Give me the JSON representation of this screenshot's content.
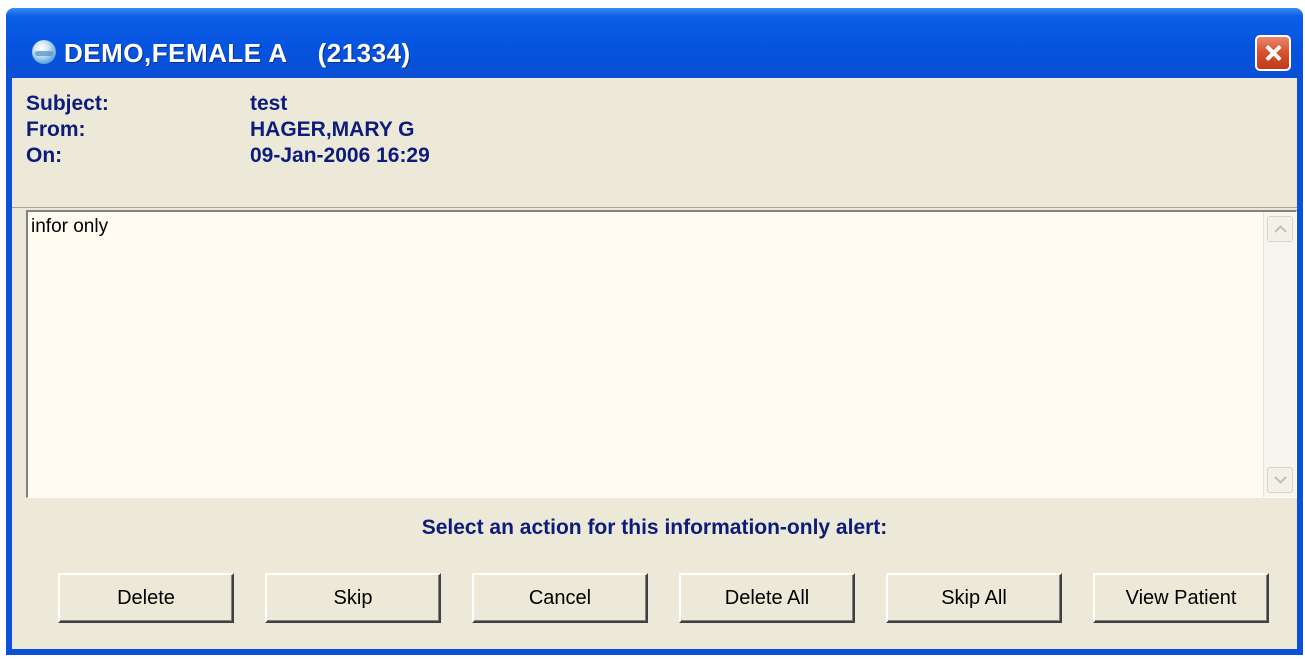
{
  "window": {
    "title": "DEMO,FEMALE A    (21334)",
    "close_icon": "close-icon"
  },
  "header": {
    "subject_label": "Subject:",
    "subject_value": "test",
    "from_label": "From:",
    "from_value": "HAGER,MARY G",
    "on_label": "On:",
    "on_value": "09-Jan-2006 16:29"
  },
  "memo": {
    "text": "infor only"
  },
  "prompt": "Select an action for this information-only alert:",
  "buttons": [
    {
      "label": "Delete"
    },
    {
      "label": "Skip"
    },
    {
      "label": "Cancel"
    },
    {
      "label": "Delete All"
    },
    {
      "label": "Skip All"
    },
    {
      "label": "View Patient"
    }
  ],
  "colors": {
    "titlebar": "#0554e0",
    "header_text": "#0d1b7a",
    "client_bg": "#ece9d8",
    "memo_bg": "#fffbf0"
  }
}
